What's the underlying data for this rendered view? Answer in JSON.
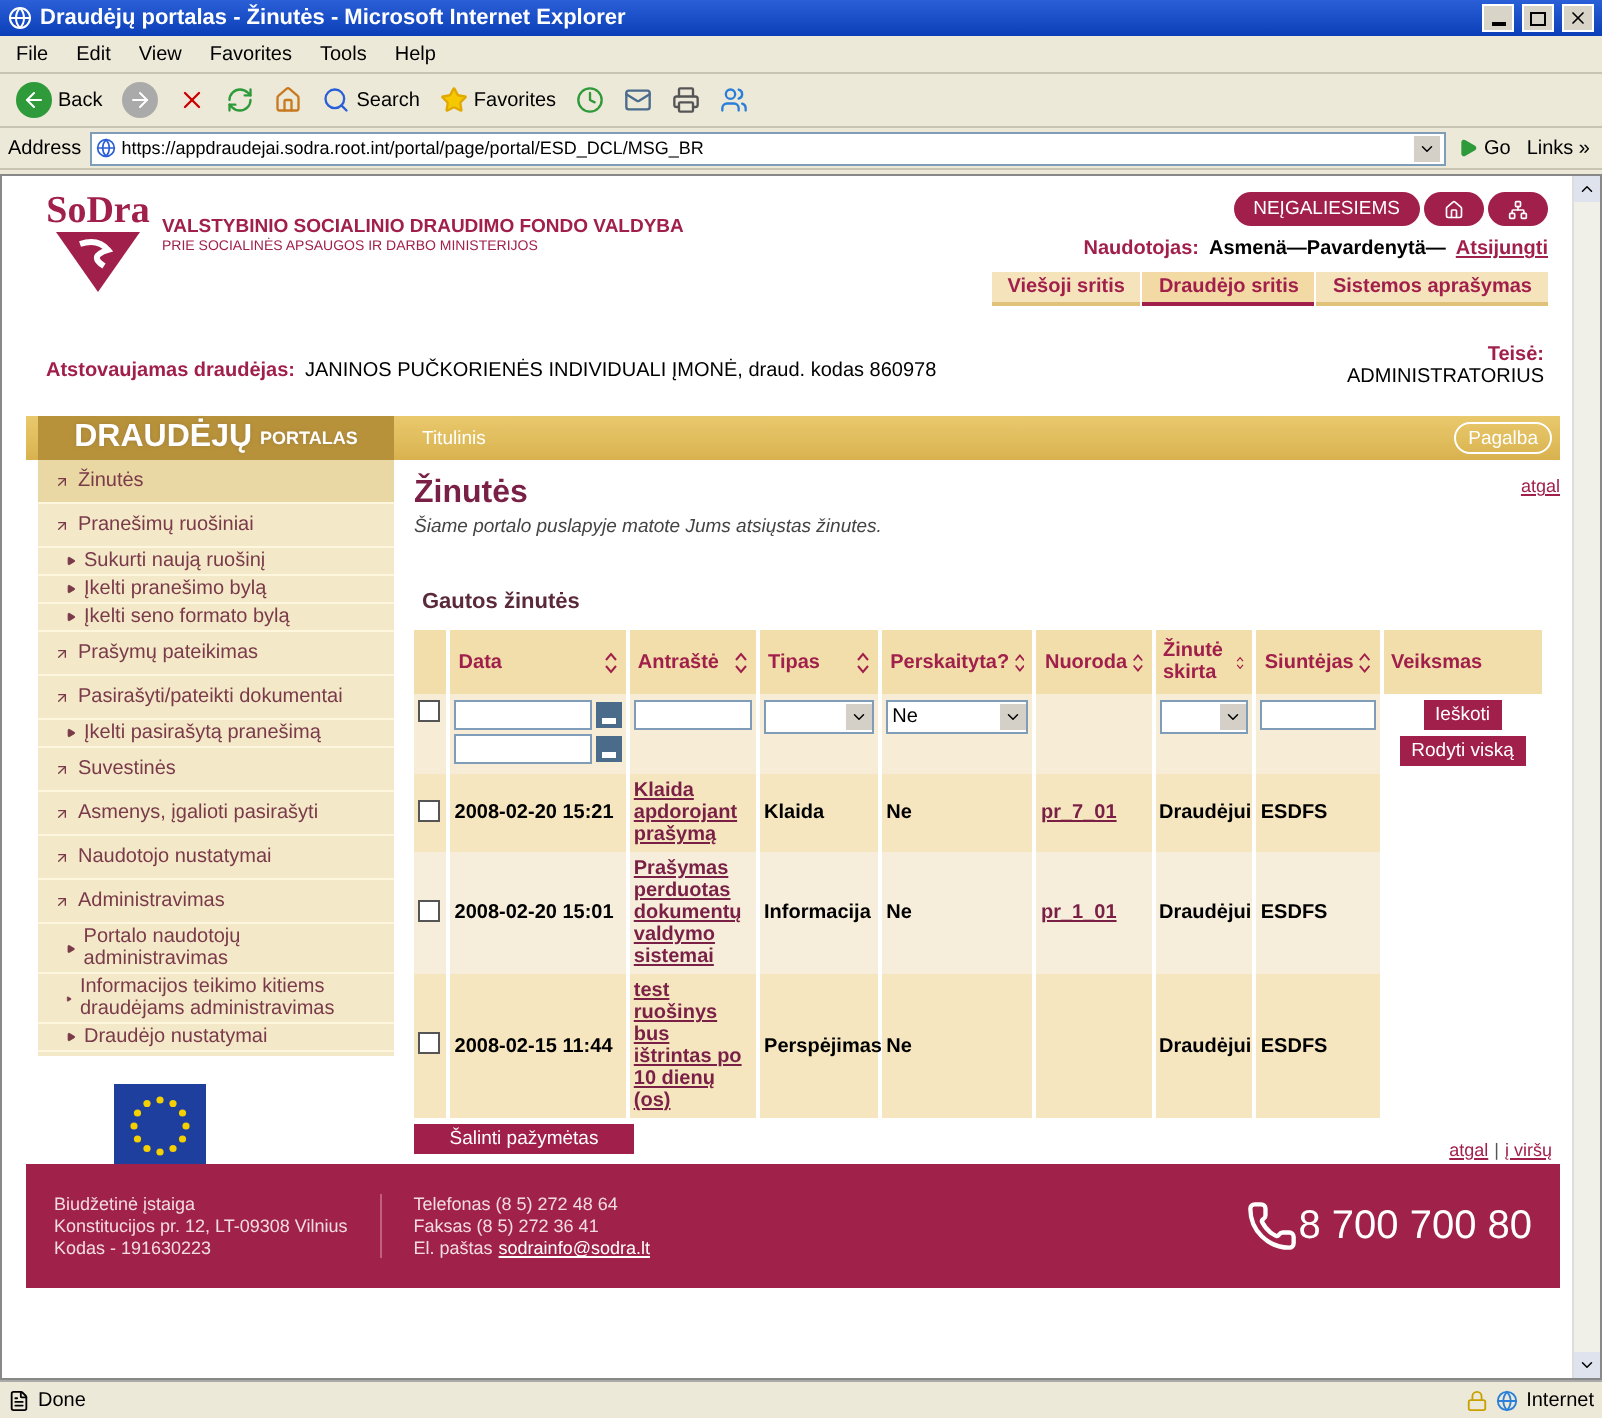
{
  "window": {
    "title": "Draudėjų portalas - Žinutės - Microsoft Internet Explorer"
  },
  "menu": [
    "File",
    "Edit",
    "View",
    "Favorites",
    "Tools",
    "Help"
  ],
  "toolbar": {
    "back": "Back",
    "search": "Search",
    "favorites": "Favorites"
  },
  "address": {
    "label": "Address",
    "value": "https://appdraudejai.sodra.root.int/portal/page/portal/ESD_DCL/MSG_BR",
    "go": "Go",
    "links": "Links »"
  },
  "header": {
    "logo": "SoDra",
    "org_name": "VALSTYBINIO SOCIALINIO DRAUDIMO FONDO VALDYBA",
    "org_sub": "PRIE SOCIALINĖS APSAUGOS IR DARBO MINISTERIJOS",
    "accessibility": "NEĮGALIESIEMS",
    "user_label": "Naudotojas:",
    "user_value": "Asmenä—Pavardenytä—",
    "logout": "Atsijungti",
    "sections": [
      {
        "label": "Viešoji sritis",
        "selected": false
      },
      {
        "label": "Draudėjo sritis",
        "selected": true
      },
      {
        "label": "Sistemos aprašymas",
        "selected": false
      }
    ],
    "insurer_label": "Atstovaujamas draudėjas:",
    "insurer_value": "JANINOS PUČKORIENĖS INDIVIDUALI ĮMONĖ, draud. kodas 860978",
    "rights_label": "Teisė:",
    "rights_value": "ADMINISTRATORIUS"
  },
  "portal": {
    "title": "DRAUDĖJŲ",
    "title_small": "PORTALAS",
    "breadcrumb": "Titulinis",
    "help": "Pagalba"
  },
  "sidebar": {
    "items": [
      {
        "label": "Žinutės",
        "selected": true
      },
      {
        "label": "Pranešimų ruošiniai",
        "selected": false,
        "children": [
          {
            "label": "Sukurti naują ruošinį"
          },
          {
            "label": "Įkelti pranešimo bylą"
          },
          {
            "label": "Įkelti seno formato bylą"
          }
        ]
      },
      {
        "label": "Prašymų pateikimas",
        "selected": false
      },
      {
        "label": "Pasirašyti/pateikti dokumentai",
        "selected": false,
        "children": [
          {
            "label": "Įkelti pasirašytą pranešimą"
          }
        ]
      },
      {
        "label": "Suvestinės",
        "selected": false
      },
      {
        "label": "Asmenys, įgalioti pasirašyti",
        "selected": false
      },
      {
        "label": "Naudotojo nustatymai",
        "selected": false
      },
      {
        "label": "Administravimas",
        "selected": false,
        "children": [
          {
            "label": "Portalo naudotojų administravimas"
          },
          {
            "label": "Informacijos teikimo kitiems draudėjams administravimas"
          },
          {
            "label": "Draudėjo nustatymai"
          }
        ]
      }
    ]
  },
  "main": {
    "title": "Žinutės",
    "subtitle": "Šiame portalo puslapyje matote Jums atsiųstas žinutes.",
    "back": "atgal",
    "section_title": "Gautos žinutės",
    "columns": [
      {
        "label": "Data",
        "sortable": true
      },
      {
        "label": "Antraštė",
        "sortable": true
      },
      {
        "label": "Tipas",
        "sortable": true
      },
      {
        "label": "Perskaityta?",
        "sortable": true
      },
      {
        "label": "Nuoroda",
        "sortable": true
      },
      {
        "label": "Žinutė skirta",
        "sortable": true
      },
      {
        "label": "Siuntėjas",
        "sortable": true
      },
      {
        "label": "Veiksmas",
        "sortable": false
      }
    ],
    "filter": {
      "checked": false,
      "read_value": "Ne",
      "search": "Ieškoti",
      "show_all": "Rodyti viską"
    },
    "rows": [
      {
        "checked": false,
        "date": "2008-02-20 15:21",
        "title": "Klaida apdorojant prašymą",
        "type": "Klaida",
        "read": "Ne",
        "link": "pr_7_01",
        "to": "Draudėjui",
        "from": "ESDFS"
      },
      {
        "checked": false,
        "date": "2008-02-20 15:01",
        "title": "Prašymas perduotas dokumentų valdymo sistemai",
        "type": "Informacija",
        "read": "Ne",
        "link": "pr_1_01",
        "to": "Draudėjui",
        "from": "ESDFS"
      },
      {
        "checked": false,
        "date": "2008-02-15 11:44",
        "title": "test ruošinys bus ištrintas po 10 dienų (os)",
        "type": "Perspėjimas",
        "read": "Ne",
        "link": "",
        "to": "Draudėjui",
        "from": "ESDFS"
      }
    ],
    "delete": "Šalinti pažymėtas"
  },
  "footer": {
    "back": "atgal",
    "separator": "|",
    "top": "į viršų",
    "col1": [
      "Biudžetinė įstaiga",
      "Konstitucijos pr. 12, LT-09308 Vilnius",
      "Kodas - 191630223"
    ],
    "col2": [
      "Telefonas (8 5) 272 48 64",
      "Faksas (8 5) 272 36 41"
    ],
    "email_label": "El. paštas",
    "email": "sodrainfo@sodra.lt",
    "phone": "8 700 700 80"
  },
  "status": {
    "text": "Done",
    "zone": "Internet"
  }
}
